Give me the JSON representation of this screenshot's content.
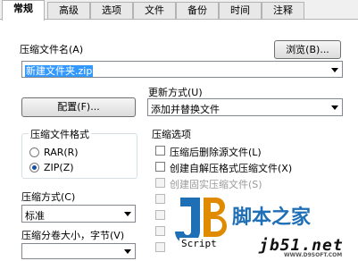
{
  "tabs": [
    "常规",
    "高级",
    "选项",
    "文件",
    "备份",
    "时间",
    "注释"
  ],
  "archive_name_label": "压缩文件名(A)",
  "browse_button": "浏览(B)...",
  "archive_name_value": "新建文件夹.zip",
  "update_mode_label": "更新方式(U)",
  "update_mode_value": "添加并替换文件",
  "profiles_button": "配置(F)...",
  "format_group": {
    "title": "压缩文件格式",
    "options": [
      {
        "label": "RAR(R)",
        "selected": false
      },
      {
        "label": "ZIP(Z)",
        "selected": true
      }
    ]
  },
  "options_group": {
    "title": "压缩选项",
    "items": [
      {
        "label": "压缩后删除源文件(L)",
        "checked": false,
        "disabled": false
      },
      {
        "label": "创建自解压格式压缩文件(X)",
        "checked": false,
        "disabled": false
      },
      {
        "label": "创建固实压缩文件(S)",
        "checked": false,
        "disabled": true
      }
    ]
  },
  "method_label": "压缩方式(C)",
  "method_value": "标准",
  "volume_label": "压缩分卷大小，字节(V)",
  "watermark": {
    "text1": "脚本之家",
    "text2": "jb51.net",
    "badge": "Script",
    "small": "WWW.D9SOFT.COM"
  }
}
